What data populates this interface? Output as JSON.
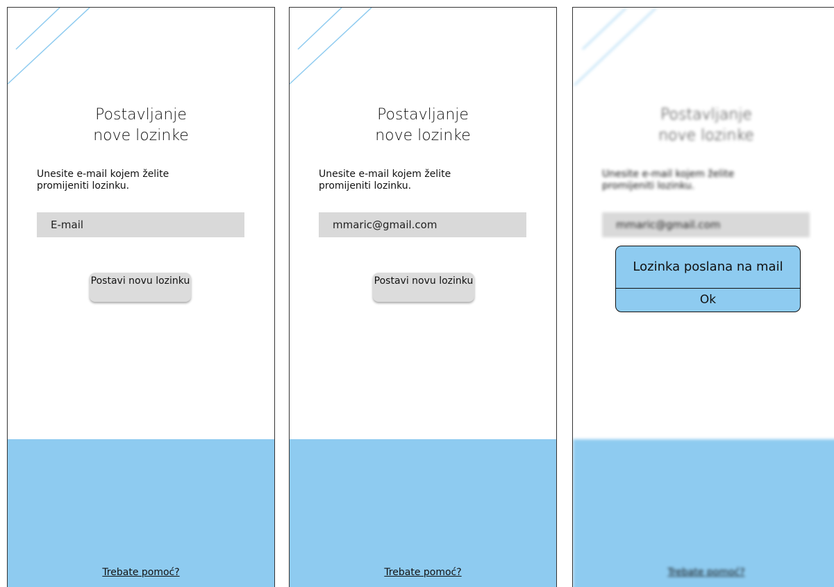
{
  "screens": [
    {
      "title_line1": "Postavljanje",
      "title_line2": "nove lozinke",
      "instruction": "Unesite e-mail kojem želite promijeniti lozinku.",
      "email_placeholder": "E-mail",
      "email_value": "",
      "submit_label": "Postavi novu lozinku",
      "help_link": "Trebate pomoć?"
    },
    {
      "title_line1": "Postavljanje",
      "title_line2": "nove lozinke",
      "instruction": "Unesite e-mail kojem želite promijeniti lozinku.",
      "email_value": "mmaric@gmail.com",
      "submit_label": "Postavi novu lozinku",
      "help_link": "Trebate pomoć?"
    },
    {
      "title_line1": "Postavljanje",
      "title_line2": "nove lozinke",
      "instruction": "Unesite e-mail kojem želite promijeniti lozinku.",
      "email_value": "mmaric@gmail.com",
      "help_link": "Trebate pomoć?",
      "dialog": {
        "message": "Lozinka poslana na mail",
        "ok_label": "Ok"
      }
    }
  ],
  "colors": {
    "accent_blue": "#8ecbf0",
    "field_gray": "#d9d9d9",
    "button_gray": "#dcdcdc"
  }
}
